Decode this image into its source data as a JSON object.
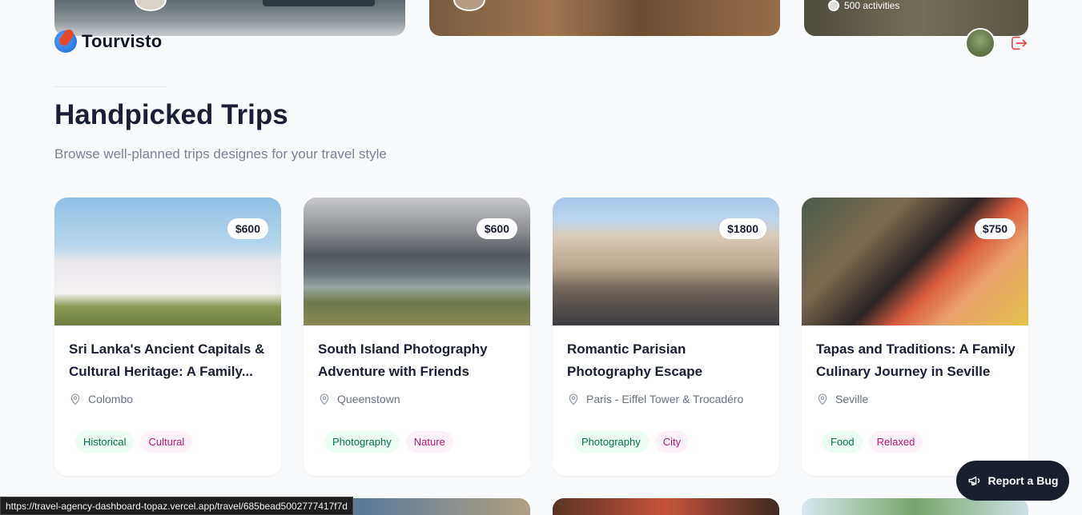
{
  "top_cards": {
    "activities_label": "500 activities"
  },
  "header": {
    "brand": "Tourvisto"
  },
  "section": {
    "title": "Handpicked Trips",
    "subtitle": "Browse well-planned trips designes for your travel style"
  },
  "trips": [
    {
      "price": "$600",
      "title": "Sri Lanka's Ancient Capitals & Cultural Heritage: A Family...",
      "location": "Colombo",
      "tags": [
        "Historical",
        "Cultural"
      ]
    },
    {
      "price": "$600",
      "title": "South Island Photography Adventure with Friends",
      "location": "Queenstown",
      "tags": [
        "Photography",
        "Nature"
      ]
    },
    {
      "price": "$1800",
      "title": "Romantic Parisian Photography Escape",
      "location": "Paris - Eiffel Tower & Trocadéro",
      "tags": [
        "Photography",
        "City"
      ]
    },
    {
      "price": "$750",
      "title": "Tapas and Traditions: A Family Culinary Journey in Seville",
      "location": "Seville",
      "tags": [
        "Food",
        "Relaxed"
      ]
    }
  ],
  "report_bug": {
    "label": "Report a Bug"
  },
  "status_bar": {
    "url": "https://travel-agency-dashboard-topaz.vercel.app/travel/685bead5002777417f7d"
  },
  "colors": {
    "background": "#f8fafc",
    "logout_icon": "#ef4444",
    "tag_green_text": "#067647",
    "tag_pink_text": "#c11574"
  },
  "icons": [
    "globe-logo-icon",
    "logout-icon",
    "location-pin-icon",
    "megaphone-icon"
  ]
}
